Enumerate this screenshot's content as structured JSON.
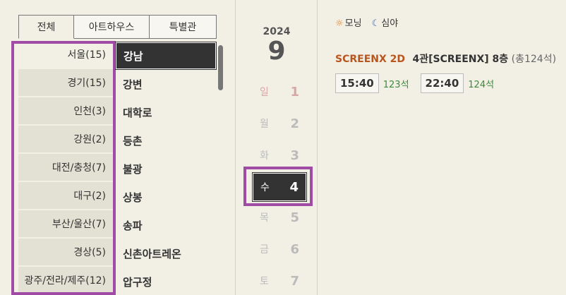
{
  "tabs": [
    {
      "label": "전체",
      "active": true
    },
    {
      "label": "아트하우스",
      "active": false
    },
    {
      "label": "특별관",
      "active": false
    }
  ],
  "regions": [
    "서울(15)",
    "경기(15)",
    "인천(3)",
    "강원(2)",
    "대전/충청(7)",
    "대구(2)",
    "부산/울산(7)",
    "경상(5)",
    "광주/전라/제주(12)"
  ],
  "theaters": [
    "강남",
    "강변",
    "대학로",
    "등촌",
    "불광",
    "상봉",
    "송파",
    "신촌아트레온",
    "압구정"
  ],
  "date": {
    "year": "2024",
    "month": "9",
    "days": [
      {
        "dow": "일",
        "num": "1"
      },
      {
        "dow": "월",
        "num": "2"
      },
      {
        "dow": "화",
        "num": "3"
      },
      {
        "dow": "수",
        "num": "4"
      },
      {
        "dow": "목",
        "num": "5"
      },
      {
        "dow": "금",
        "num": "6"
      },
      {
        "dow": "토",
        "num": "7"
      }
    ]
  },
  "legend": {
    "morning": "모닝",
    "night": "심야"
  },
  "movie": {
    "type": "SCREENX 2D",
    "hall": "4관[SCREENX] 8층",
    "total": "(총124석)"
  },
  "times": [
    {
      "time": "15:40",
      "seats": "123석"
    },
    {
      "time": "22:40",
      "seats": "124석"
    }
  ],
  "colors": {
    "highlight": "#a04ba6",
    "accent_orange": "#b9551e",
    "seat_green": "#3c8a3c"
  }
}
